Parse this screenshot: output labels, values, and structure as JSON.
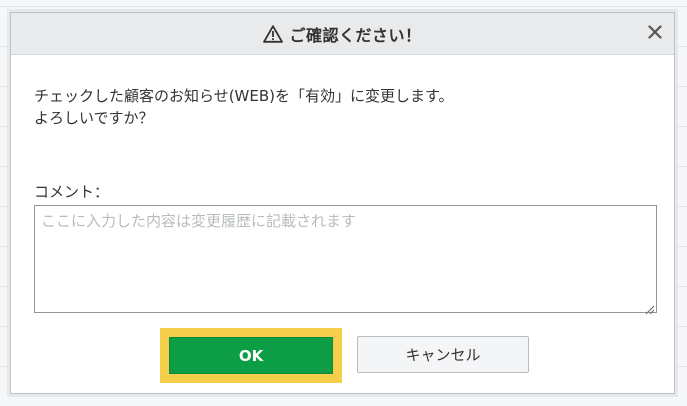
{
  "dialog": {
    "title": "ご確認ください！",
    "close_symbol": "✕",
    "message_line1": "チェックした顧客のお知らせ(WEB)を「有効」に変更します。",
    "message_line2": "よろしいですか？",
    "comment_label": "コメント：",
    "comment_placeholder": "ここに入力した内容は変更履歴に記載されます",
    "comment_value": "",
    "ok_label": "OK",
    "cancel_label": "キャンセル"
  },
  "icons": {
    "title_icon": "warning-icon",
    "close_icon": "close-icon"
  },
  "colors": {
    "ok_button": "#0d9d44",
    "ok_highlight": "#f5cf4b",
    "titlebar": "#e8eaeb",
    "text": "#333333"
  }
}
